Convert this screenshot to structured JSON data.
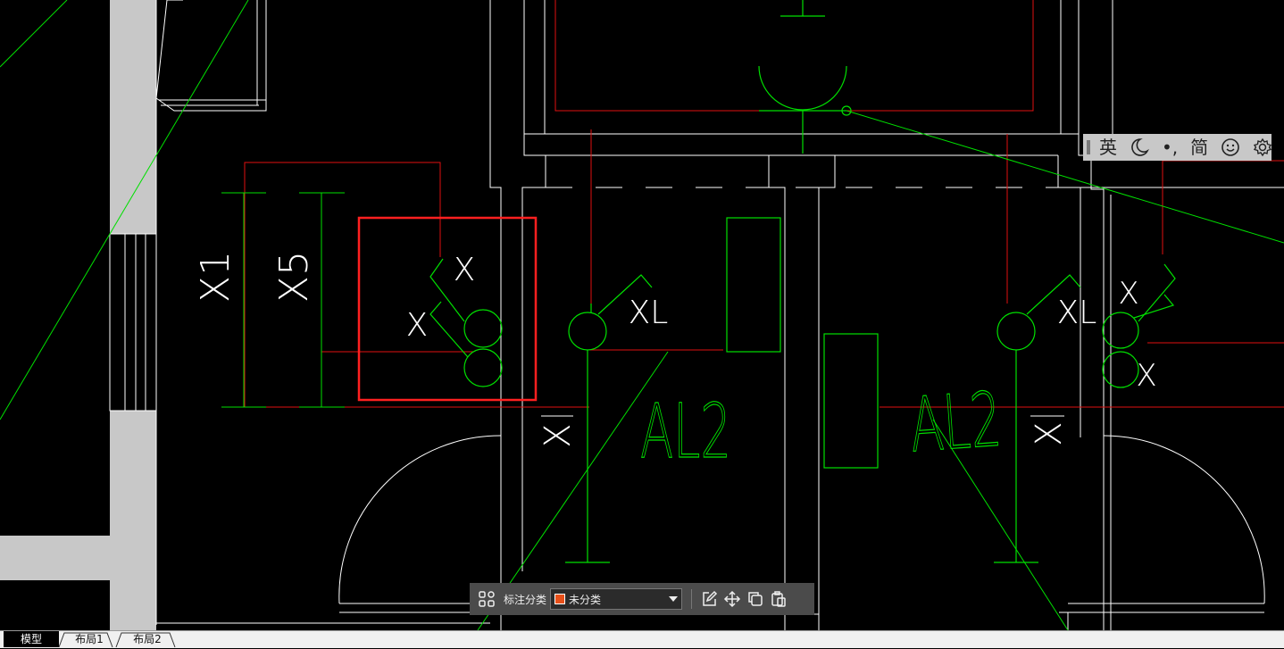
{
  "drawing": {
    "dimension_labels": [
      "X1",
      "X5"
    ],
    "tags": {
      "x_upper": "X",
      "x_lower": "X",
      "xl_left": "XL",
      "xl_right": "XL",
      "x_right_upper": "X",
      "x_right_lower": "X",
      "x_vertical_left": "X",
      "x_vertical_right": "X"
    },
    "panels": {
      "left": "AL2",
      "right": "AL2"
    },
    "colors": {
      "background": "#000000",
      "wall": "#c8c8c8",
      "line_white": "#ffffff",
      "line_green": "#00e000",
      "line_red": "#e01010",
      "selection": "#ff2020"
    }
  },
  "ime_bar": {
    "language": "英",
    "moon_icon": "moon-icon",
    "punctuation": "•,",
    "script": "简",
    "emoji_icon": "smiley-icon",
    "settings_icon": "gear-icon"
  },
  "annotation_toolbar": {
    "category_label": "标注分类",
    "selected_category": "未分类",
    "swatch_color": "#e8501a"
  },
  "tabs": [
    {
      "label": "模型",
      "active": true
    },
    {
      "label": "布局1",
      "active": false
    },
    {
      "label": "布局2",
      "active": false
    }
  ]
}
